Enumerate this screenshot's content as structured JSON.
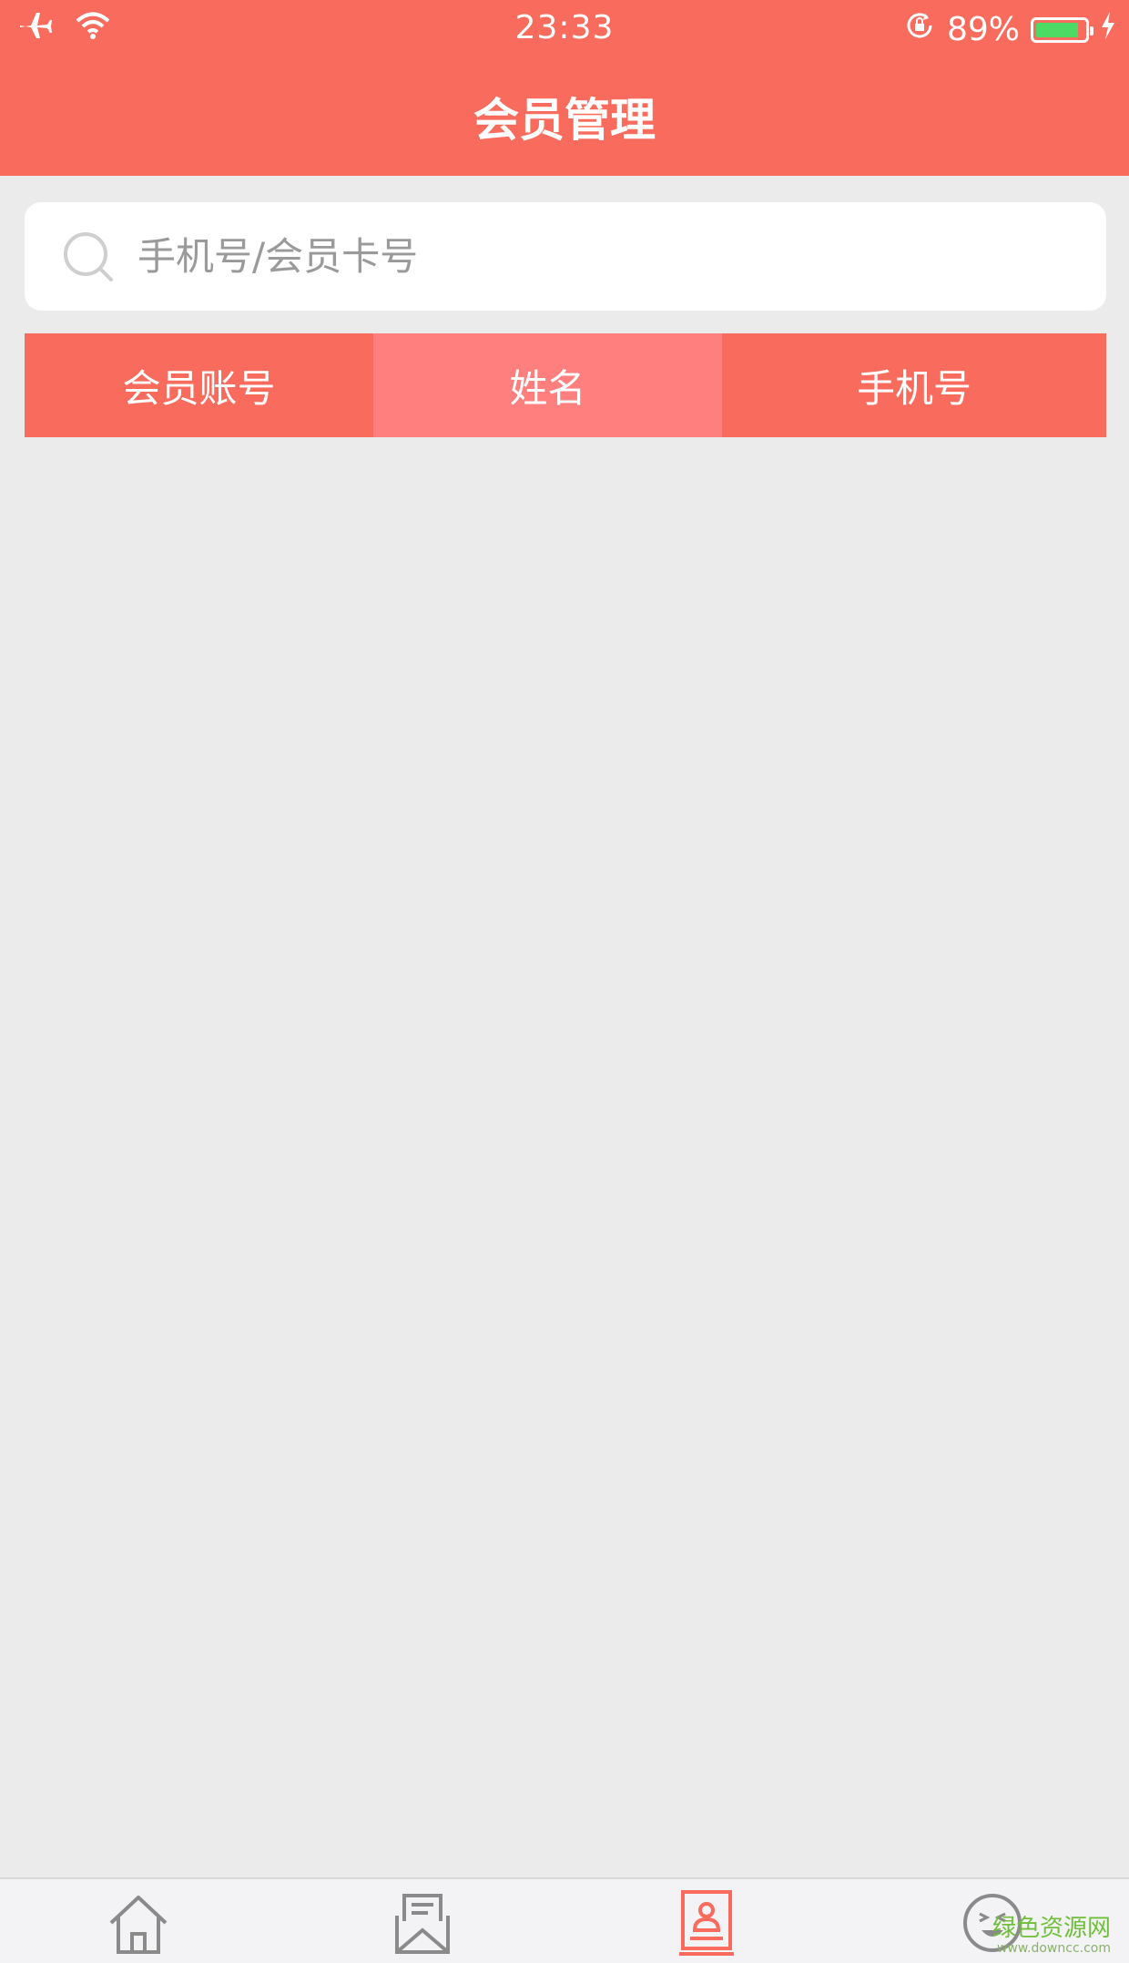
{
  "status_bar": {
    "time": "23:33",
    "battery_percent": "89%",
    "battery_level": 0.89,
    "icons": [
      "airplane-icon",
      "wifi-icon",
      "rotation-lock-icon",
      "battery-icon",
      "charging-icon"
    ]
  },
  "header": {
    "title": "会员管理"
  },
  "search": {
    "placeholder": "手机号/会员卡号",
    "value": ""
  },
  "table_header": {
    "columns": [
      {
        "label": "会员账号",
        "active": false
      },
      {
        "label": "姓名",
        "active": true
      },
      {
        "label": "手机号",
        "active": false
      }
    ]
  },
  "tab_bar": {
    "items": [
      {
        "icon": "home-icon"
      },
      {
        "icon": "mail-icon"
      },
      {
        "icon": "member-card-icon",
        "active": true
      },
      {
        "icon": "smiley-face-icon"
      }
    ]
  },
  "watermark": {
    "brand": "绿色资源网",
    "url": "www.downcc.com"
  },
  "colors": {
    "primary": "#f96b5c",
    "active_column": "#ff7f7f",
    "background": "#ebebeb",
    "watermark": "#6fbf3a"
  }
}
